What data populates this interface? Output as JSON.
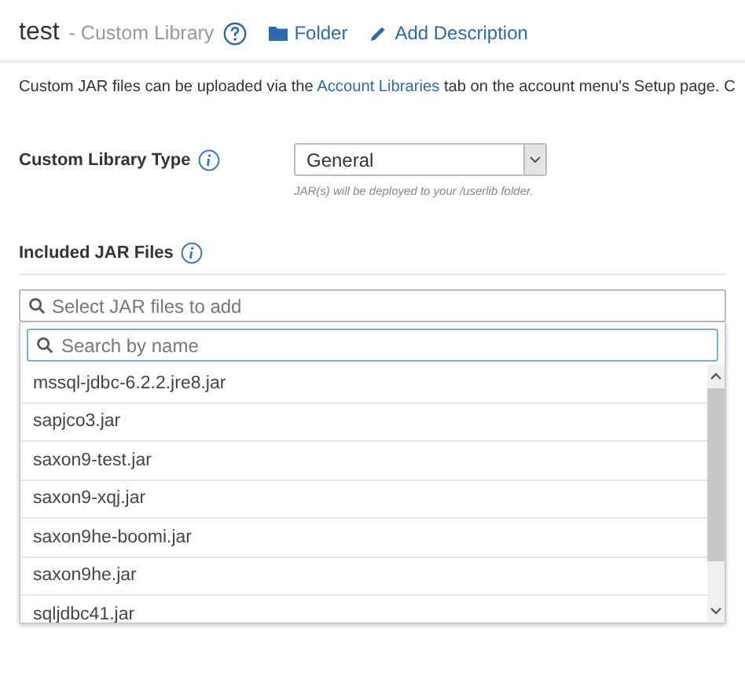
{
  "header": {
    "title": "test",
    "subtitle": "- Custom Library",
    "links": [
      {
        "kind": "folder",
        "label": "Folder"
      },
      {
        "kind": "edit",
        "label": "Add Description"
      }
    ]
  },
  "intro": {
    "before": "Custom JAR files can be uploaded via the",
    "link": "Account Libraries",
    "after": "tab on the account menu's Setup page. C"
  },
  "library_type": {
    "label": "Custom Library Type",
    "value": "General",
    "hint": "JAR(s) will be deployed to your /userlib folder."
  },
  "included": {
    "label": "Included JAR Files",
    "field": {
      "placeholder": "Select JAR files to add"
    },
    "dropdown": {
      "search": {
        "placeholder": "Search by name"
      },
      "items": [
        {
          "label": "mssql-jdbc-6.2.2.jre8.jar"
        },
        {
          "label": "sapjco3.jar"
        },
        {
          "label": "saxon9-test.jar"
        },
        {
          "label": "saxon9-xqj.jar"
        },
        {
          "label": "saxon9he-boomi.jar"
        },
        {
          "label": "saxon9he.jar"
        },
        {
          "label": "sqljdbc41.jar"
        }
      ]
    }
  }
}
